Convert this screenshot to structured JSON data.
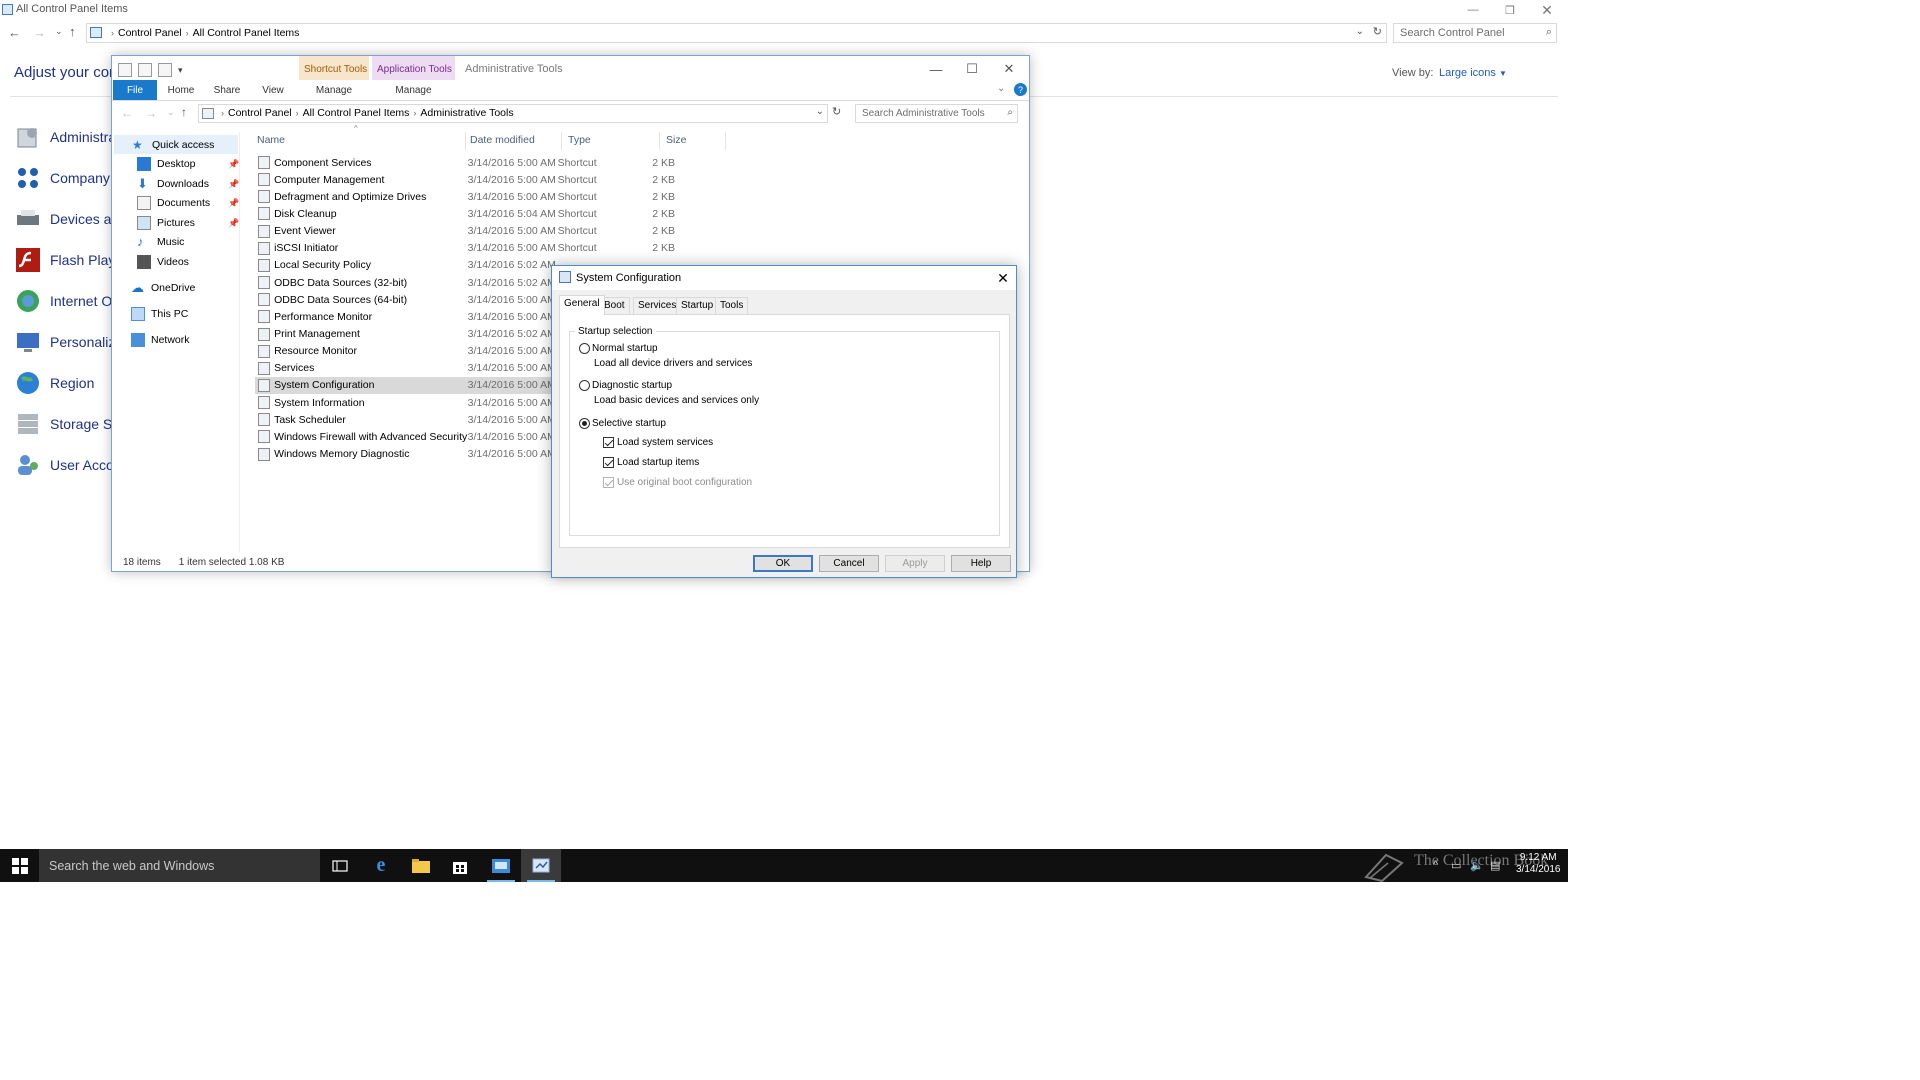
{
  "control_panel": {
    "title": "All Control Panel Items",
    "breadcrumb": [
      "Control Panel",
      "All Control Panel Items"
    ],
    "search_placeholder": "Search Control Panel",
    "heading": "Adjust your comp",
    "view_by_label": "View by:",
    "view_by_value": "Large icons",
    "items": [
      {
        "label": "Administra",
        "icon": "administrative-tools-icon"
      },
      {
        "label": "Company S",
        "icon": "company-icon"
      },
      {
        "label": "Devices an",
        "icon": "devices-printers-icon"
      },
      {
        "label": "Flash Playe",
        "icon": "flash-player-icon"
      },
      {
        "label": "Internet Op",
        "icon": "internet-options-icon"
      },
      {
        "label": "Personaliza",
        "icon": "personalization-icon"
      },
      {
        "label": "Region",
        "icon": "region-icon"
      },
      {
        "label": "Storage Sp",
        "icon": "storage-spaces-icon"
      },
      {
        "label": "User Accou",
        "icon": "user-accounts-icon"
      }
    ]
  },
  "explorer": {
    "title": "Administrative Tools",
    "context_tabs": {
      "shortcut": "Shortcut Tools",
      "application": "Application Tools"
    },
    "ribbon_tabs": [
      "File",
      "Home",
      "Share",
      "View",
      "Manage",
      "Manage"
    ],
    "breadcrumb": [
      "Control Panel",
      "All Control Panel Items",
      "Administrative Tools"
    ],
    "search_placeholder": "Search Administrative Tools",
    "sidebar": {
      "quick_access": "Quick access",
      "pinned": [
        "Desktop",
        "Downloads",
        "Documents",
        "Pictures"
      ],
      "unpinned": [
        "Music",
        "Videos"
      ],
      "onedrive": "OneDrive",
      "this_pc": "This PC",
      "network": "Network"
    },
    "columns": {
      "name": "Name",
      "date": "Date modified",
      "type": "Type",
      "size": "Size"
    },
    "files": [
      {
        "name": "Component Services",
        "date": "3/14/2016 5:00 AM",
        "type": "Shortcut",
        "size": "2 KB"
      },
      {
        "name": "Computer Management",
        "date": "3/14/2016 5:00 AM",
        "type": "Shortcut",
        "size": "2 KB"
      },
      {
        "name": "Defragment and Optimize Drives",
        "date": "3/14/2016 5:00 AM",
        "type": "Shortcut",
        "size": "2 KB"
      },
      {
        "name": "Disk Cleanup",
        "date": "3/14/2016 5:04 AM",
        "type": "Shortcut",
        "size": "2 KB"
      },
      {
        "name": "Event Viewer",
        "date": "3/14/2016 5:00 AM",
        "type": "Shortcut",
        "size": "2 KB"
      },
      {
        "name": "iSCSI Initiator",
        "date": "3/14/2016 5:00 AM",
        "type": "Shortcut",
        "size": "2 KB"
      },
      {
        "name": "Local Security Policy",
        "date": "3/14/2016 5:02 AM",
        "type": "",
        "size": ""
      },
      {
        "name": "ODBC Data Sources (32-bit)",
        "date": "3/14/2016 5:02 AM",
        "type": "",
        "size": ""
      },
      {
        "name": "ODBC Data Sources (64-bit)",
        "date": "3/14/2016 5:00 AM",
        "type": "",
        "size": ""
      },
      {
        "name": "Performance Monitor",
        "date": "3/14/2016 5:00 AM",
        "type": "",
        "size": ""
      },
      {
        "name": "Print Management",
        "date": "3/14/2016 5:02 AM",
        "type": "",
        "size": ""
      },
      {
        "name": "Resource Monitor",
        "date": "3/14/2016 5:00 AM",
        "type": "",
        "size": ""
      },
      {
        "name": "Services",
        "date": "3/14/2016 5:00 AM",
        "type": "",
        "size": ""
      },
      {
        "name": "System Configuration",
        "date": "3/14/2016 5:00 AM",
        "type": "",
        "size": "",
        "selected": true
      },
      {
        "name": "System Information",
        "date": "3/14/2016 5:00 AM",
        "type": "",
        "size": ""
      },
      {
        "name": "Task Scheduler",
        "date": "3/14/2016 5:00 AM",
        "type": "",
        "size": ""
      },
      {
        "name": "Windows Firewall with Advanced Security",
        "date": "3/14/2016 5:00 AM",
        "type": "",
        "size": ""
      },
      {
        "name": "Windows Memory Diagnostic",
        "date": "3/14/2016 5:00 AM",
        "type": "",
        "size": ""
      }
    ],
    "status": {
      "count": "18 items",
      "selection": "1 item selected  1.08 KB"
    }
  },
  "msconfig": {
    "title": "System Configuration",
    "tabs": [
      "General",
      "Boot",
      "Services",
      "Startup",
      "Tools"
    ],
    "active_tab": "General",
    "group_label": "Startup selection",
    "normal": {
      "label": "Normal startup",
      "desc": "Load all device drivers and services",
      "selected": false
    },
    "diagnostic": {
      "label": "Diagnostic startup",
      "desc": "Load basic devices and services only",
      "selected": false
    },
    "selective": {
      "label": "Selective startup",
      "selected": true
    },
    "checks": [
      {
        "label": "Load system services",
        "checked": true,
        "enabled": true
      },
      {
        "label": "Load startup items",
        "checked": true,
        "enabled": true
      },
      {
        "label": "Use original boot configuration",
        "checked": true,
        "enabled": false
      }
    ],
    "buttons": {
      "ok": "OK",
      "cancel": "Cancel",
      "apply": "Apply",
      "help": "Help"
    }
  },
  "taskbar": {
    "search_placeholder": "Search the web and Windows",
    "watermark": "The Collection Book",
    "time": "9:12 AM",
    "date": "3/14/2016"
  },
  "colors": {
    "accent": "#1979ca",
    "link": "#1e3287",
    "taskbar": "#101010",
    "selection": "#d9d9d9"
  }
}
